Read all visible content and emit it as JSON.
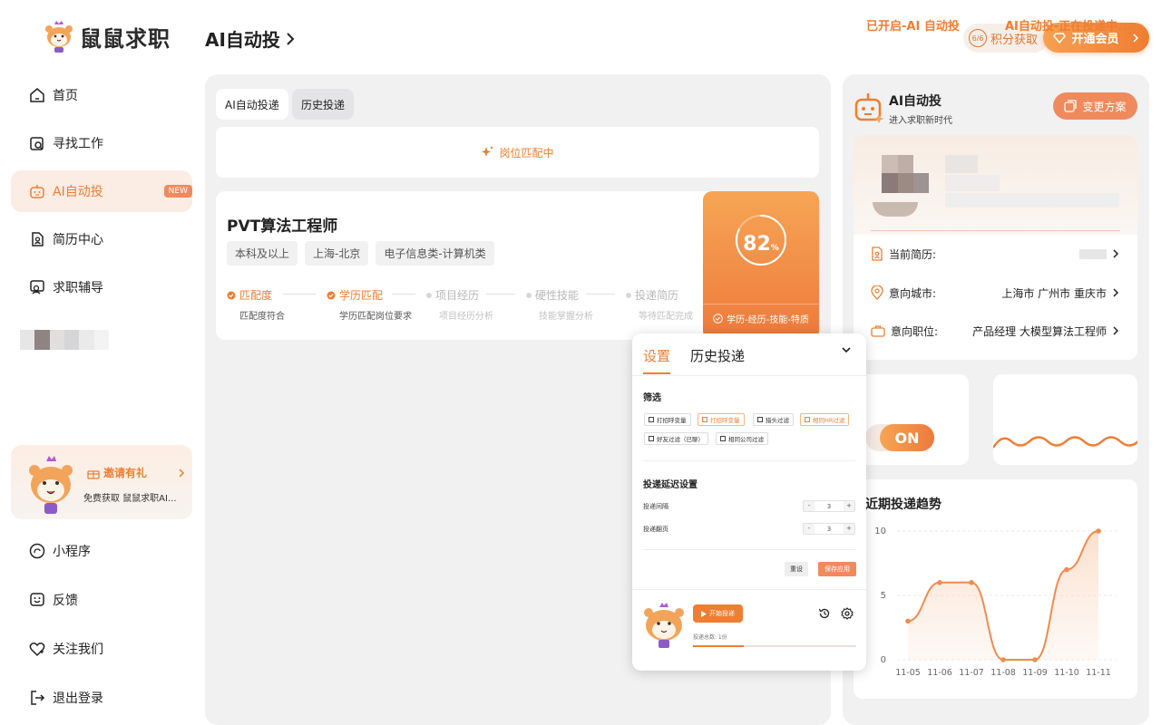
{
  "header": {
    "brand": "鼠鼠求职",
    "page_title": "AI自动投",
    "points_label": "积分获取",
    "points_badge": "6/6",
    "vip_label": "开通会员"
  },
  "sidebar": {
    "items": [
      {
        "label": "首页",
        "icon": "home-icon"
      },
      {
        "label": "寻找工作",
        "icon": "search-job-icon"
      },
      {
        "label": "AI自动投",
        "icon": "robot-icon",
        "badge": "NEW",
        "active": true
      },
      {
        "label": "简历中心",
        "icon": "resume-icon"
      },
      {
        "label": "求职辅导",
        "icon": "coaching-icon"
      }
    ],
    "invite": {
      "title": "邀请有礼",
      "subtitle": "免费获取 鼠鼠求职AI..."
    },
    "bottom_items": [
      {
        "label": "小程序",
        "icon": "mini-program-icon"
      },
      {
        "label": "反馈",
        "icon": "feedback-icon"
      },
      {
        "label": "关注我们",
        "icon": "follow-icon"
      },
      {
        "label": "退出登录",
        "icon": "logout-icon"
      }
    ]
  },
  "main": {
    "tabs": [
      "AI自动投递",
      "历史投递"
    ],
    "matching_text": "岗位匹配中",
    "job": {
      "title": "PVT算法工程师",
      "tags": [
        "本科及以上",
        "上海-北京",
        "电子信息类-计算机类"
      ],
      "steps": [
        {
          "label": "匹配度",
          "sub": "匹配度符合",
          "done": true
        },
        {
          "label": "学历匹配",
          "sub": "学历匹配岗位要求",
          "done": true
        },
        {
          "label": "项目经历",
          "sub": "项目经历分析",
          "done": false
        },
        {
          "label": "硬性技能",
          "sub": "技能掌握分析",
          "done": false
        },
        {
          "label": "投递简历",
          "sub": "等待匹配完成",
          "done": false
        }
      ],
      "score": "82",
      "score_unit": "%",
      "score_fraction": 0.82,
      "score_footer": "学历-经历-技能-特质"
    }
  },
  "settings_popover": {
    "tab_settings": "设置",
    "tab_history": "历史投递",
    "filter_title": "筛选",
    "filters": [
      {
        "label": "打招呼变量",
        "checked": false
      },
      {
        "label": "打招呼变量",
        "checked": true
      },
      {
        "label": "猎头过滤",
        "checked": false
      },
      {
        "label": "相同HR过滤",
        "checked": true
      },
      {
        "label": "好友过滤（已聊）",
        "checked": false
      },
      {
        "label": "相同公司过滤",
        "checked": false
      }
    ],
    "delay_title": "投递延迟设置",
    "delay_rows": [
      {
        "label": "投递间隔",
        "value": "3"
      },
      {
        "label": "投递翻页",
        "value": "3"
      }
    ],
    "reset_label": "重设",
    "save_label": "保存应用",
    "start_label": "开始投递",
    "count_text": "投递总数: 1份",
    "progress_fraction": 0.31
  },
  "right": {
    "title": "AI自动投",
    "subtitle": "进入求职新时代",
    "change_plan_label": "变更方案",
    "current_resume_label": "当前简历:",
    "city_label": "意向城市:",
    "city_value": "上海市 广州市 重庆市",
    "position_label": "意向职位:",
    "position_value": "产品经理 大模型算法工程师",
    "status_enabled": "已开启-AI 自动投",
    "toggle_label": "ON",
    "status_delivering": "AI自动投-正在投递中...",
    "colors": {
      "accent": "#ef7d32",
      "accent_light": "#f6a554"
    }
  },
  "chart_data": {
    "type": "area",
    "title": "近期投递趋势",
    "categories": [
      "11-05",
      "11-06",
      "11-07",
      "11-08",
      "11-09",
      "11-10",
      "11-11"
    ],
    "values": [
      3,
      6,
      6,
      0,
      0,
      7,
      10
    ],
    "ylim": [
      0,
      10
    ],
    "yticks": [
      "0",
      "5",
      "10"
    ],
    "grid": true
  }
}
